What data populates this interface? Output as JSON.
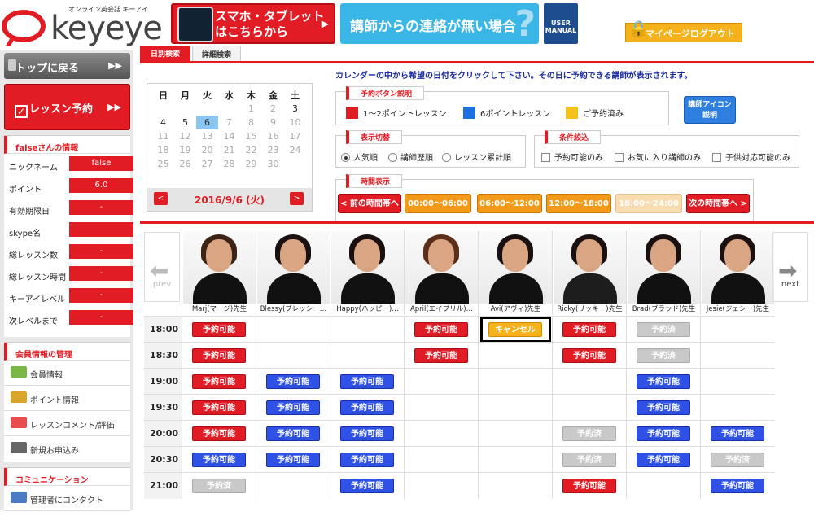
{
  "header": {
    "logo_tagline": "オンライン英会話 キーアイ",
    "logo_word": "keyeye",
    "smartphone_banner": "スマホ・タブレット\nはこちらから",
    "contact_banner": "講師からの連絡が無い場合",
    "manual_label": "USER\nMANUAL",
    "logout_label": "マイページログアウト"
  },
  "sidebar": {
    "top_button": "トップに戻る",
    "lesson_button": "レッスン予約",
    "info_title": "falseさんの情報",
    "info": [
      {
        "key": "ニックネーム",
        "value": "false"
      },
      {
        "key": "ポイント",
        "value": "6.0"
      },
      {
        "key": "有効期限日",
        "value": "-"
      },
      {
        "key": "skype名",
        "value": ""
      },
      {
        "key": "総レッスン数",
        "value": "-"
      },
      {
        "key": "総レッスン時間",
        "value": "-"
      },
      {
        "key": "キーアイレベル",
        "value": "-"
      },
      {
        "key": "次レベルまで",
        "value": "-"
      }
    ],
    "member_title": "会員情報の管理",
    "member_items": [
      "会員情報",
      "ポイント情報",
      "レッスンコメント/評価",
      "新規お申込み"
    ],
    "comm_title": "コミュニケーション",
    "comm_items": [
      "管理者にコンタクト"
    ]
  },
  "tabs": [
    "日別検索",
    "詳細検索"
  ],
  "instruction": "カレンダーの中から希望の日付をクリックして下さい。その日に予約できる講師が表示されます。",
  "calendar": {
    "weekdays": [
      "日",
      "月",
      "火",
      "水",
      "木",
      "金",
      "土"
    ],
    "weeks": [
      [
        "",
        "",
        "",
        "",
        "1",
        "2",
        "3"
      ],
      [
        "4",
        "5",
        "6",
        "7",
        "8",
        "9",
        "10"
      ],
      [
        "11",
        "12",
        "13",
        "14",
        "15",
        "16",
        "17"
      ],
      [
        "18",
        "19",
        "20",
        "21",
        "22",
        "23",
        "24"
      ],
      [
        "25",
        "26",
        "27",
        "28",
        "29",
        "30",
        ""
      ]
    ],
    "selected": "6",
    "current_date": "2016/9/6 (火)",
    "prev_label": "<",
    "next_label": ">"
  },
  "legend": {
    "title": "予約ボタン説明",
    "items": [
      {
        "label": "1～2ポイントレッスン",
        "color": "#e21c24"
      },
      {
        "label": "6ポイントレッスン",
        "color": "#1f6fe0"
      },
      {
        "label": "ご予約済み",
        "color": "#f5c21a"
      }
    ],
    "icon_button": "講師アイコン\n説明"
  },
  "display": {
    "title": "表示切替",
    "options": [
      "人気順",
      "講師歴順",
      "レッスン累計順"
    ],
    "selected": "人気順"
  },
  "filter": {
    "title": "条件絞込",
    "options": [
      "予約可能のみ",
      "お気に入り講師のみ",
      "子供対応可能のみ"
    ]
  },
  "time_display": {
    "title": "時間表示",
    "buttons": [
      {
        "label": "< 前の時間帯へ",
        "style": "red"
      },
      {
        "label": "00:00～06:00",
        "style": "orange"
      },
      {
        "label": "06:00～12:00",
        "style": "orange"
      },
      {
        "label": "12:00～18:00",
        "style": "orange"
      },
      {
        "label": "18:00～24:00",
        "style": "pale"
      },
      {
        "label": "次の時間帯へ >",
        "style": "red"
      }
    ]
  },
  "schedule": {
    "prev_label": "prev",
    "next_label": "next",
    "teachers": [
      "Marj(マージ)先生",
      "Blessy(ブレッシー…",
      "Happy(ハッピー)…",
      "April(エイプリル)…",
      "Avi(アヴィ)先生",
      "Ricky(リッキー)先生",
      "Brad(ブラッド)先生",
      "Jesie(ジェシー)先生"
    ],
    "rows": [
      {
        "time": "18:00",
        "cells": [
          [
            "予約可能",
            "red"
          ],
          null,
          null,
          [
            "予約可能",
            "red"
          ],
          [
            "キャンセル",
            "yel"
          ],
          [
            "予約可能",
            "red"
          ],
          [
            "予約済",
            "gray"
          ],
          null
        ]
      },
      {
        "time": "18:30",
        "cells": [
          [
            "予約可能",
            "red"
          ],
          null,
          null,
          [
            "予約可能",
            "red"
          ],
          null,
          [
            "予約可能",
            "red"
          ],
          [
            "予約済",
            "gray"
          ],
          null
        ]
      },
      {
        "time": "19:00",
        "cells": [
          [
            "予約可能",
            "red"
          ],
          [
            "予約可能",
            "blue"
          ],
          [
            "予約可能",
            "blue"
          ],
          null,
          null,
          null,
          [
            "予約可能",
            "blue"
          ],
          null
        ]
      },
      {
        "time": "19:30",
        "cells": [
          [
            "予約可能",
            "red"
          ],
          [
            "予約可能",
            "blue"
          ],
          [
            "予約可能",
            "blue"
          ],
          null,
          null,
          null,
          [
            "予約可能",
            "blue"
          ],
          null
        ]
      },
      {
        "time": "20:00",
        "cells": [
          [
            "予約可能",
            "red"
          ],
          [
            "予約可能",
            "blue"
          ],
          [
            "予約可能",
            "blue"
          ],
          null,
          null,
          [
            "予約済",
            "gray"
          ],
          [
            "予約可能",
            "blue"
          ],
          [
            "予約可能",
            "blue"
          ]
        ]
      },
      {
        "time": "20:30",
        "cells": [
          [
            "予約可能",
            "blue"
          ],
          [
            "予約可能",
            "blue"
          ],
          [
            "予約可能",
            "blue"
          ],
          null,
          null,
          [
            "予約済",
            "gray"
          ],
          [
            "予約可能",
            "blue"
          ],
          [
            "予約済",
            "gray"
          ]
        ]
      },
      {
        "time": "21:00",
        "cells": [
          [
            "予約済",
            "gray"
          ],
          null,
          [
            "予約可能",
            "blue"
          ],
          null,
          null,
          [
            "予約可能",
            "red"
          ],
          null,
          [
            "予約可能",
            "blue"
          ]
        ]
      }
    ]
  }
}
